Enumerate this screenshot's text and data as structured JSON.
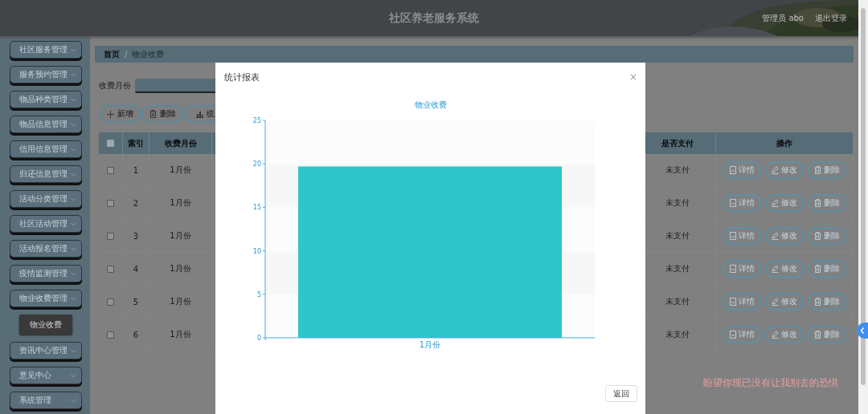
{
  "header": {
    "title": "社区养老服务系统",
    "user": "管理员 abo",
    "logout": "退出登录"
  },
  "sidebar": {
    "items": [
      {
        "label": "社区服务管理"
      },
      {
        "label": "服务预约管理"
      },
      {
        "label": "物品种类管理"
      },
      {
        "label": "物品信息管理"
      },
      {
        "label": "信用信息管理"
      },
      {
        "label": "归还信息管理"
      },
      {
        "label": "活动分类管理"
      },
      {
        "label": "社区活动管理"
      },
      {
        "label": "活动报名管理"
      },
      {
        "label": "疫情监测管理"
      },
      {
        "label": "物业收费管理",
        "children": [
          {
            "label": "物业收费",
            "selected": true
          }
        ]
      },
      {
        "label": "资讯中心管理"
      },
      {
        "label": "意见中心"
      },
      {
        "label": "系统管理"
      }
    ]
  },
  "breadcrumb": {
    "items": [
      "首页",
      "物业收费"
    ],
    "separator": "/"
  },
  "search": {
    "label": "收费月份"
  },
  "toolbar": [
    {
      "label": "新增",
      "kind": "plus"
    },
    {
      "label": "删除",
      "kind": "trash"
    },
    {
      "label": "统",
      "kind": "chart"
    }
  ],
  "table": {
    "select_all_checked": false,
    "columns": [
      "索引",
      "收费月份",
      "是否支付",
      "操作"
    ],
    "rows": [
      {
        "checked": false,
        "index": "1",
        "month": "1月份",
        "paid": "未支付",
        "actions": [
          {
            "label": "详情",
            "kind": "detail"
          },
          {
            "label": "修改",
            "kind": "edit"
          },
          {
            "label": "删除",
            "kind": "trash"
          }
        ]
      },
      {
        "checked": false,
        "index": "2",
        "month": "1月份",
        "paid": "未支付",
        "actions": [
          {
            "label": "详情",
            "kind": "detail"
          },
          {
            "label": "修改",
            "kind": "edit"
          },
          {
            "label": "删除",
            "kind": "trash"
          }
        ]
      },
      {
        "checked": false,
        "index": "3",
        "month": "1月份",
        "paid": "未支付",
        "actions": [
          {
            "label": "详情",
            "kind": "detail"
          },
          {
            "label": "修改",
            "kind": "edit"
          },
          {
            "label": "删除",
            "kind": "trash"
          }
        ]
      },
      {
        "checked": false,
        "index": "4",
        "month": "1月份",
        "paid": "未支付",
        "actions": [
          {
            "label": "详情",
            "kind": "detail"
          },
          {
            "label": "修改",
            "kind": "edit"
          },
          {
            "label": "删除",
            "kind": "trash"
          }
        ]
      },
      {
        "checked": false,
        "index": "5",
        "month": "1月份",
        "paid": "未支付",
        "actions": [
          {
            "label": "详情",
            "kind": "detail"
          },
          {
            "label": "修改",
            "kind": "edit"
          },
          {
            "label": "删除",
            "kind": "trash"
          }
        ]
      },
      {
        "checked": false,
        "index": "6",
        "month": "1月份",
        "paid": "未支付",
        "actions": [
          {
            "label": "详情",
            "kind": "detail"
          },
          {
            "label": "修改",
            "kind": "edit"
          },
          {
            "label": "删除",
            "kind": "trash"
          }
        ]
      }
    ]
  },
  "modal": {
    "title": "统计报表",
    "close": "×",
    "chart_data": {
      "type": "bar",
      "title": "物业收费",
      "categories": [
        "1月份"
      ],
      "values": [
        19.7
      ],
      "ylim": [
        0,
        25
      ],
      "yticks": [
        0,
        5,
        10,
        15,
        20,
        25
      ]
    },
    "buttons": [
      "返回"
    ]
  },
  "subtitle": "盼望你现已没有让我别去的恐惧"
}
